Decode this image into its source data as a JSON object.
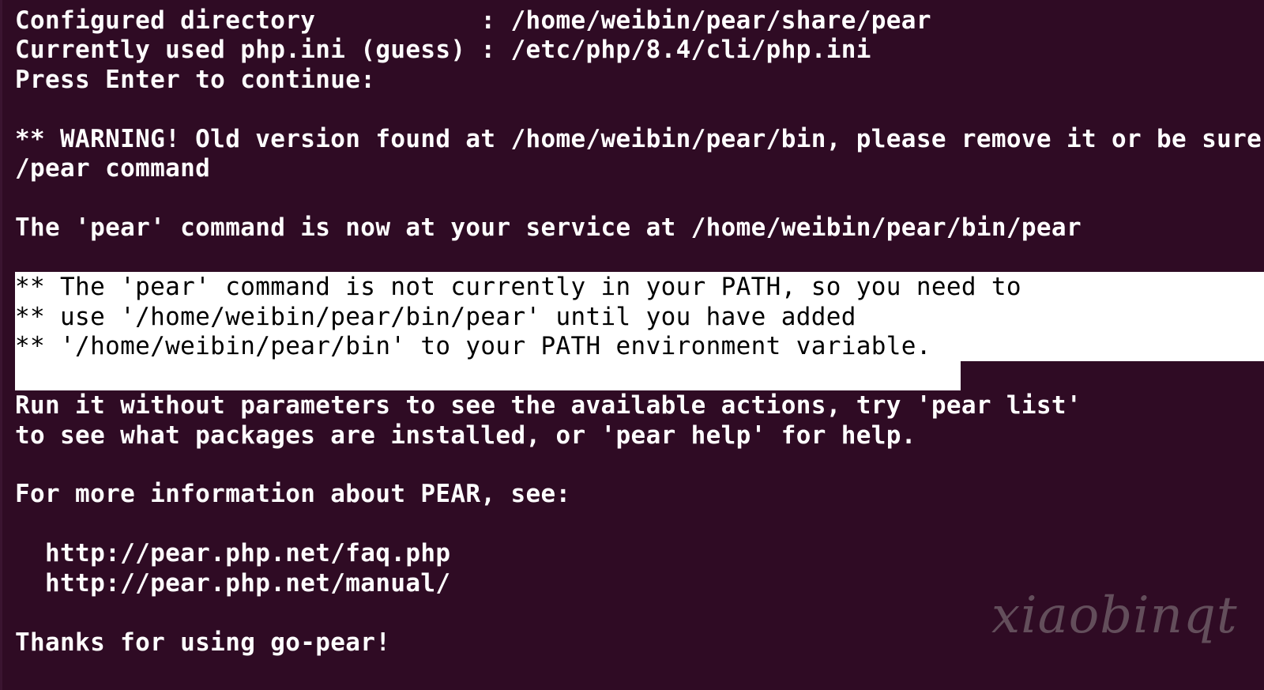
{
  "terminal": {
    "lines": [
      "Configured directory           : /home/weibin/pear/share/pear",
      "Currently used php.ini (guess) : /etc/php/8.4/cli/php.ini",
      "Press Enter to continue:",
      "",
      "** WARNING! Old version found at /home/weibin/pear/bin, please remove it or be sure",
      "/pear command",
      "",
      "The 'pear' command is now at your service at /home/weibin/pear/bin/pear",
      "",
      "** The 'pear' command is not currently in your PATH, so you need to",
      "** use '/home/weibin/pear/bin/pear' until you have added",
      "** '/home/weibin/pear/bin' to your PATH environment variable.",
      "",
      "Run it without parameters to see the available actions, try 'pear list'",
      "to see what packages are installed, or 'pear help' for help.",
      "",
      "For more information about PEAR, see:",
      "",
      "  http://pear.php.net/faq.php",
      "  http://pear.php.net/manual/",
      "",
      "Thanks for using go-pear!"
    ]
  },
  "watermark": "xiaobinqt",
  "colors": {
    "background": "#2f0b24",
    "text": "#ffffff",
    "selection_background": "#ffffff",
    "selection_text": "#000000"
  }
}
